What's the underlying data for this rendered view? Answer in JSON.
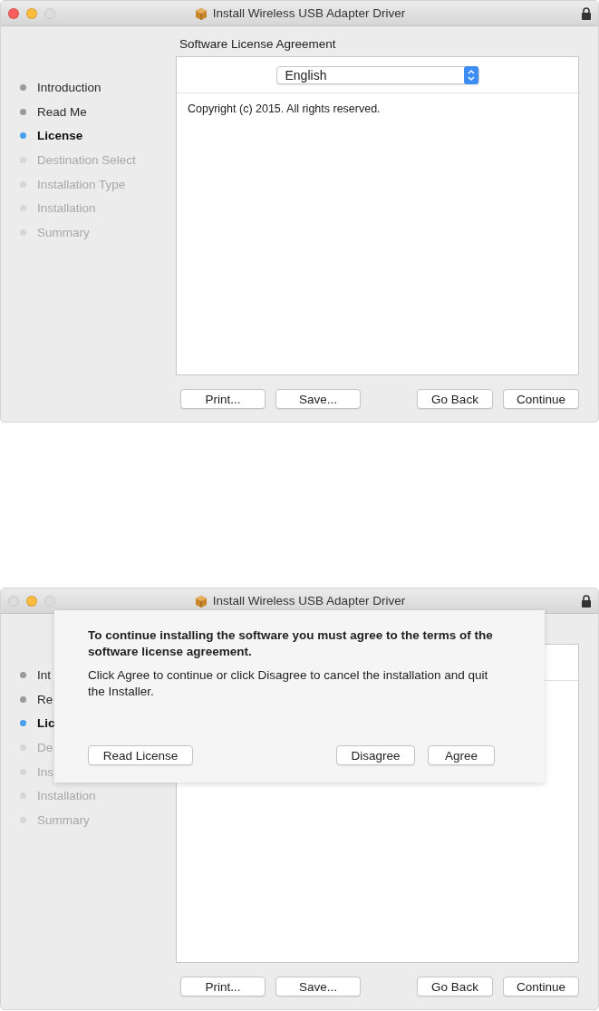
{
  "windows": [
    {
      "title": "Install Wireless USB Adapter Driver",
      "controls": [
        {
          "kind": "close",
          "enabled": true
        },
        {
          "kind": "minimize",
          "enabled": true
        },
        {
          "kind": "zoom",
          "enabled": false
        }
      ],
      "sidebar": {
        "items": [
          {
            "label": "Introduction",
            "disabled": false,
            "selected": false
          },
          {
            "label": "Read Me",
            "disabled": false,
            "selected": false
          },
          {
            "label": "License",
            "disabled": false,
            "selected": true
          },
          {
            "label": "Destination Select",
            "disabled": true,
            "selected": false
          },
          {
            "label": "Installation Type",
            "disabled": true,
            "selected": false
          },
          {
            "label": "Installation",
            "disabled": true,
            "selected": false
          },
          {
            "label": "Summary",
            "disabled": true,
            "selected": false
          }
        ]
      },
      "heading": "Software License Agreement",
      "language": "English",
      "license_text": "Copyright (c) 2015.  All rights reserved.",
      "buttons_left": [
        "Print...",
        "Save..."
      ],
      "buttons_right": [
        "Go Back",
        "Continue"
      ]
    },
    {
      "title": "Install Wireless USB Adapter Driver",
      "controls": [
        {
          "kind": "close",
          "enabled": false
        },
        {
          "kind": "minimize",
          "enabled": true
        },
        {
          "kind": "zoom",
          "enabled": false
        }
      ],
      "sidebar": {
        "items": [
          {
            "label": "Int",
            "disabled": false,
            "selected": false
          },
          {
            "label": "Re",
            "disabled": false,
            "selected": false
          },
          {
            "label": "Lic",
            "disabled": false,
            "selected": true
          },
          {
            "label": "De",
            "disabled": true,
            "selected": false
          },
          {
            "label": "Ins",
            "disabled": true,
            "selected": false
          },
          {
            "label": "Installation",
            "disabled": true,
            "selected": false
          },
          {
            "label": "Summary",
            "disabled": true,
            "selected": false
          }
        ]
      },
      "buttons_left": [
        "Print...",
        "Save..."
      ],
      "buttons_right": [
        "Go Back",
        "Continue"
      ],
      "sheet": {
        "heading": "To continue installing the software you must agree to the terms of the software license agreement.",
        "message": "Click Agree to continue or click Disagree to cancel the installation and quit the Installer.",
        "buttons_left": [
          "Read License"
        ],
        "buttons_right": [
          "Disagree",
          "Agree"
        ]
      }
    }
  ]
}
